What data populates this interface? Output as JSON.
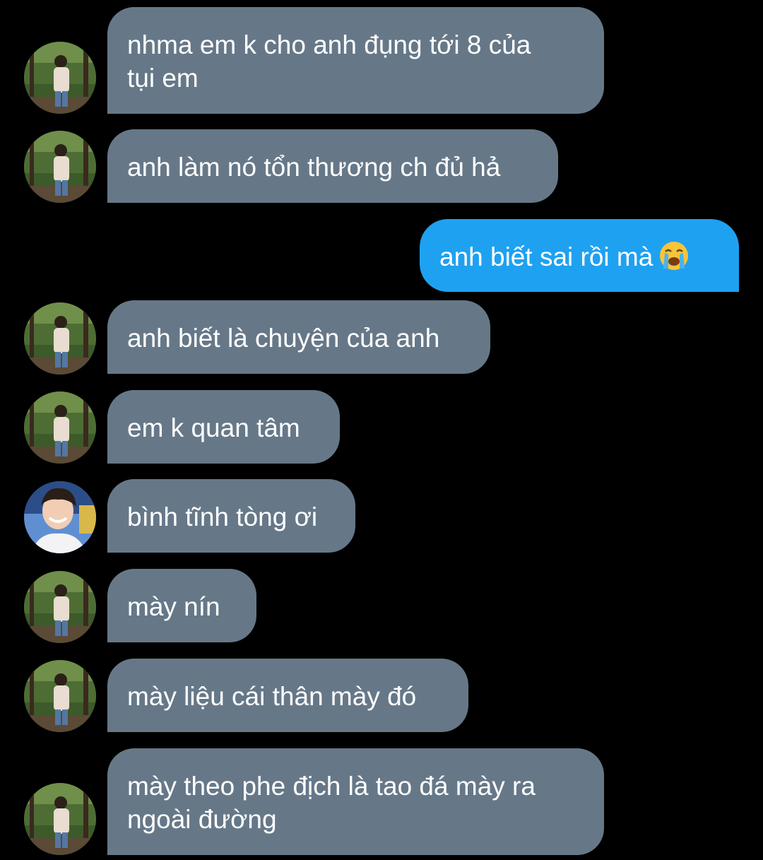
{
  "messages": [
    {
      "id": "m1",
      "side": "in",
      "text_lines": [
        "nhma em k cho anh đụng tới 8 của",
        "tụi em"
      ],
      "avatar": "friend-a"
    },
    {
      "id": "m2",
      "side": "in",
      "text_lines": [
        "anh làm nó tổn thương ch đủ hả"
      ],
      "avatar": "friend-a"
    },
    {
      "id": "m3",
      "side": "out",
      "text_lines": [
        "anh biết sai rồi mà"
      ],
      "emoji": "loudly-crying-face"
    },
    {
      "id": "m4",
      "side": "in",
      "text_lines": [
        "anh biết là chuyện của anh"
      ],
      "avatar": "friend-a"
    },
    {
      "id": "m5",
      "side": "in",
      "text_lines": [
        "em k quan tâm"
      ],
      "avatar": "friend-a"
    },
    {
      "id": "m6",
      "side": "in",
      "text_lines": [
        "bình tĩnh tòng ơi"
      ],
      "avatar": "friend-b"
    },
    {
      "id": "m7",
      "side": "in",
      "text_lines": [
        "mày nín"
      ],
      "avatar": "friend-a"
    },
    {
      "id": "m8",
      "side": "in",
      "text_lines": [
        "mày liệu cái thân mày đó"
      ],
      "avatar": "friend-a"
    },
    {
      "id": "m9",
      "side": "in",
      "text_lines": [
        "mày theo phe địch là tao đá mày ra",
        "ngoài đường"
      ],
      "avatar": "friend-a"
    }
  ],
  "colors": {
    "background": "#000000",
    "incoming_bubble": "#667888",
    "outgoing_bubble": "#1fa1f1",
    "text": "#ffffff"
  }
}
